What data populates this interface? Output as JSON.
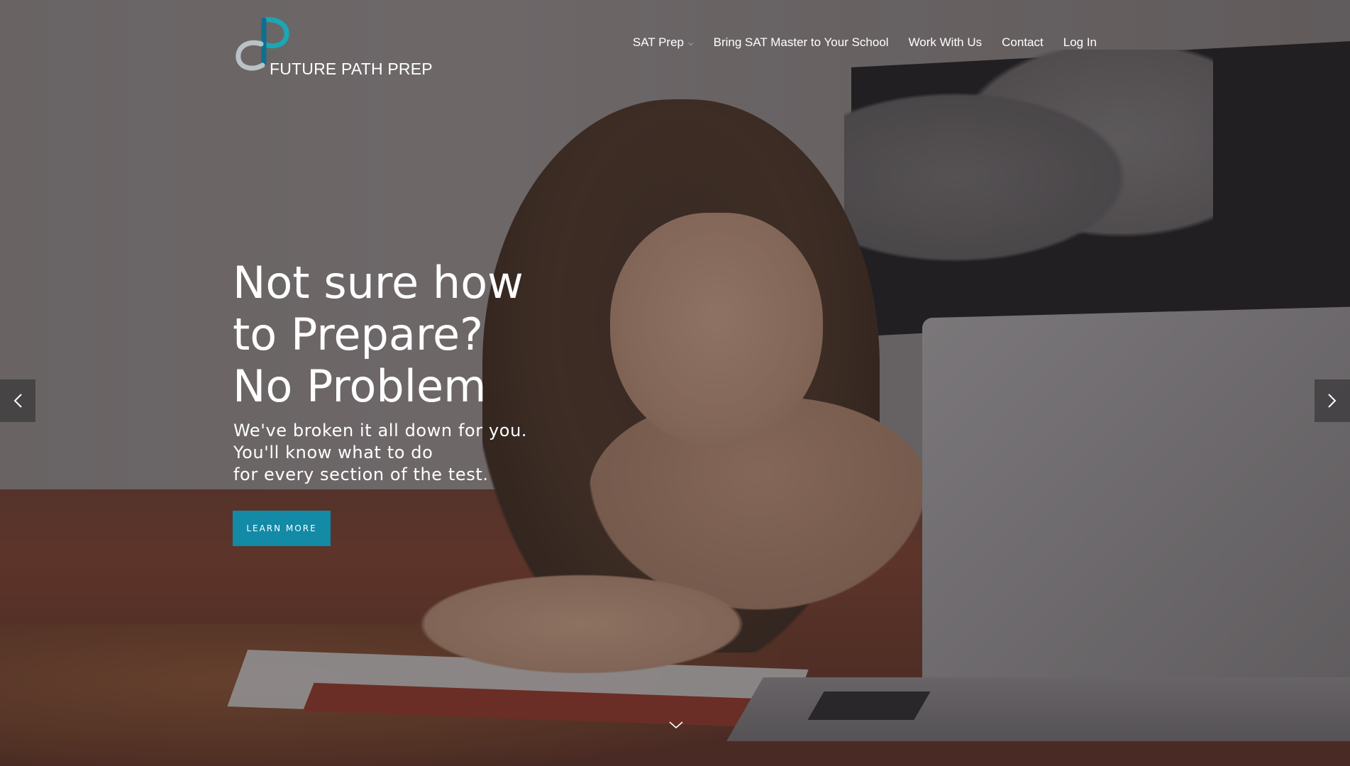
{
  "brand": {
    "name": "FUTURE PATH PREP",
    "accent_color": "#138aa6",
    "logo_mark_colors": [
      "#1aa7b5",
      "#0f6f8f",
      "#b9c2c6"
    ]
  },
  "nav": {
    "items": [
      {
        "label": "SAT Prep",
        "has_dropdown": true
      },
      {
        "label": "Bring SAT Master to Your School",
        "has_dropdown": false
      },
      {
        "label": "Work With Us",
        "has_dropdown": false
      },
      {
        "label": "Contact",
        "has_dropdown": false
      },
      {
        "label": "Log In",
        "has_dropdown": false
      }
    ],
    "dropdown_icon": "chevron-down-icon"
  },
  "hero": {
    "headline": [
      "Not sure how",
      "to Prepare?",
      "No Problem"
    ],
    "subtext": [
      "We've broken it all down for you.",
      "You'll know what to do",
      "for every section of the test."
    ],
    "cta_label": "LEARN MORE",
    "background_photo": "woman-lying-on-bed-with-laptop"
  },
  "slider": {
    "prev_icon": "chevron-left-icon",
    "next_icon": "chevron-right-icon",
    "scroll_icon": "chevron-down-icon"
  }
}
